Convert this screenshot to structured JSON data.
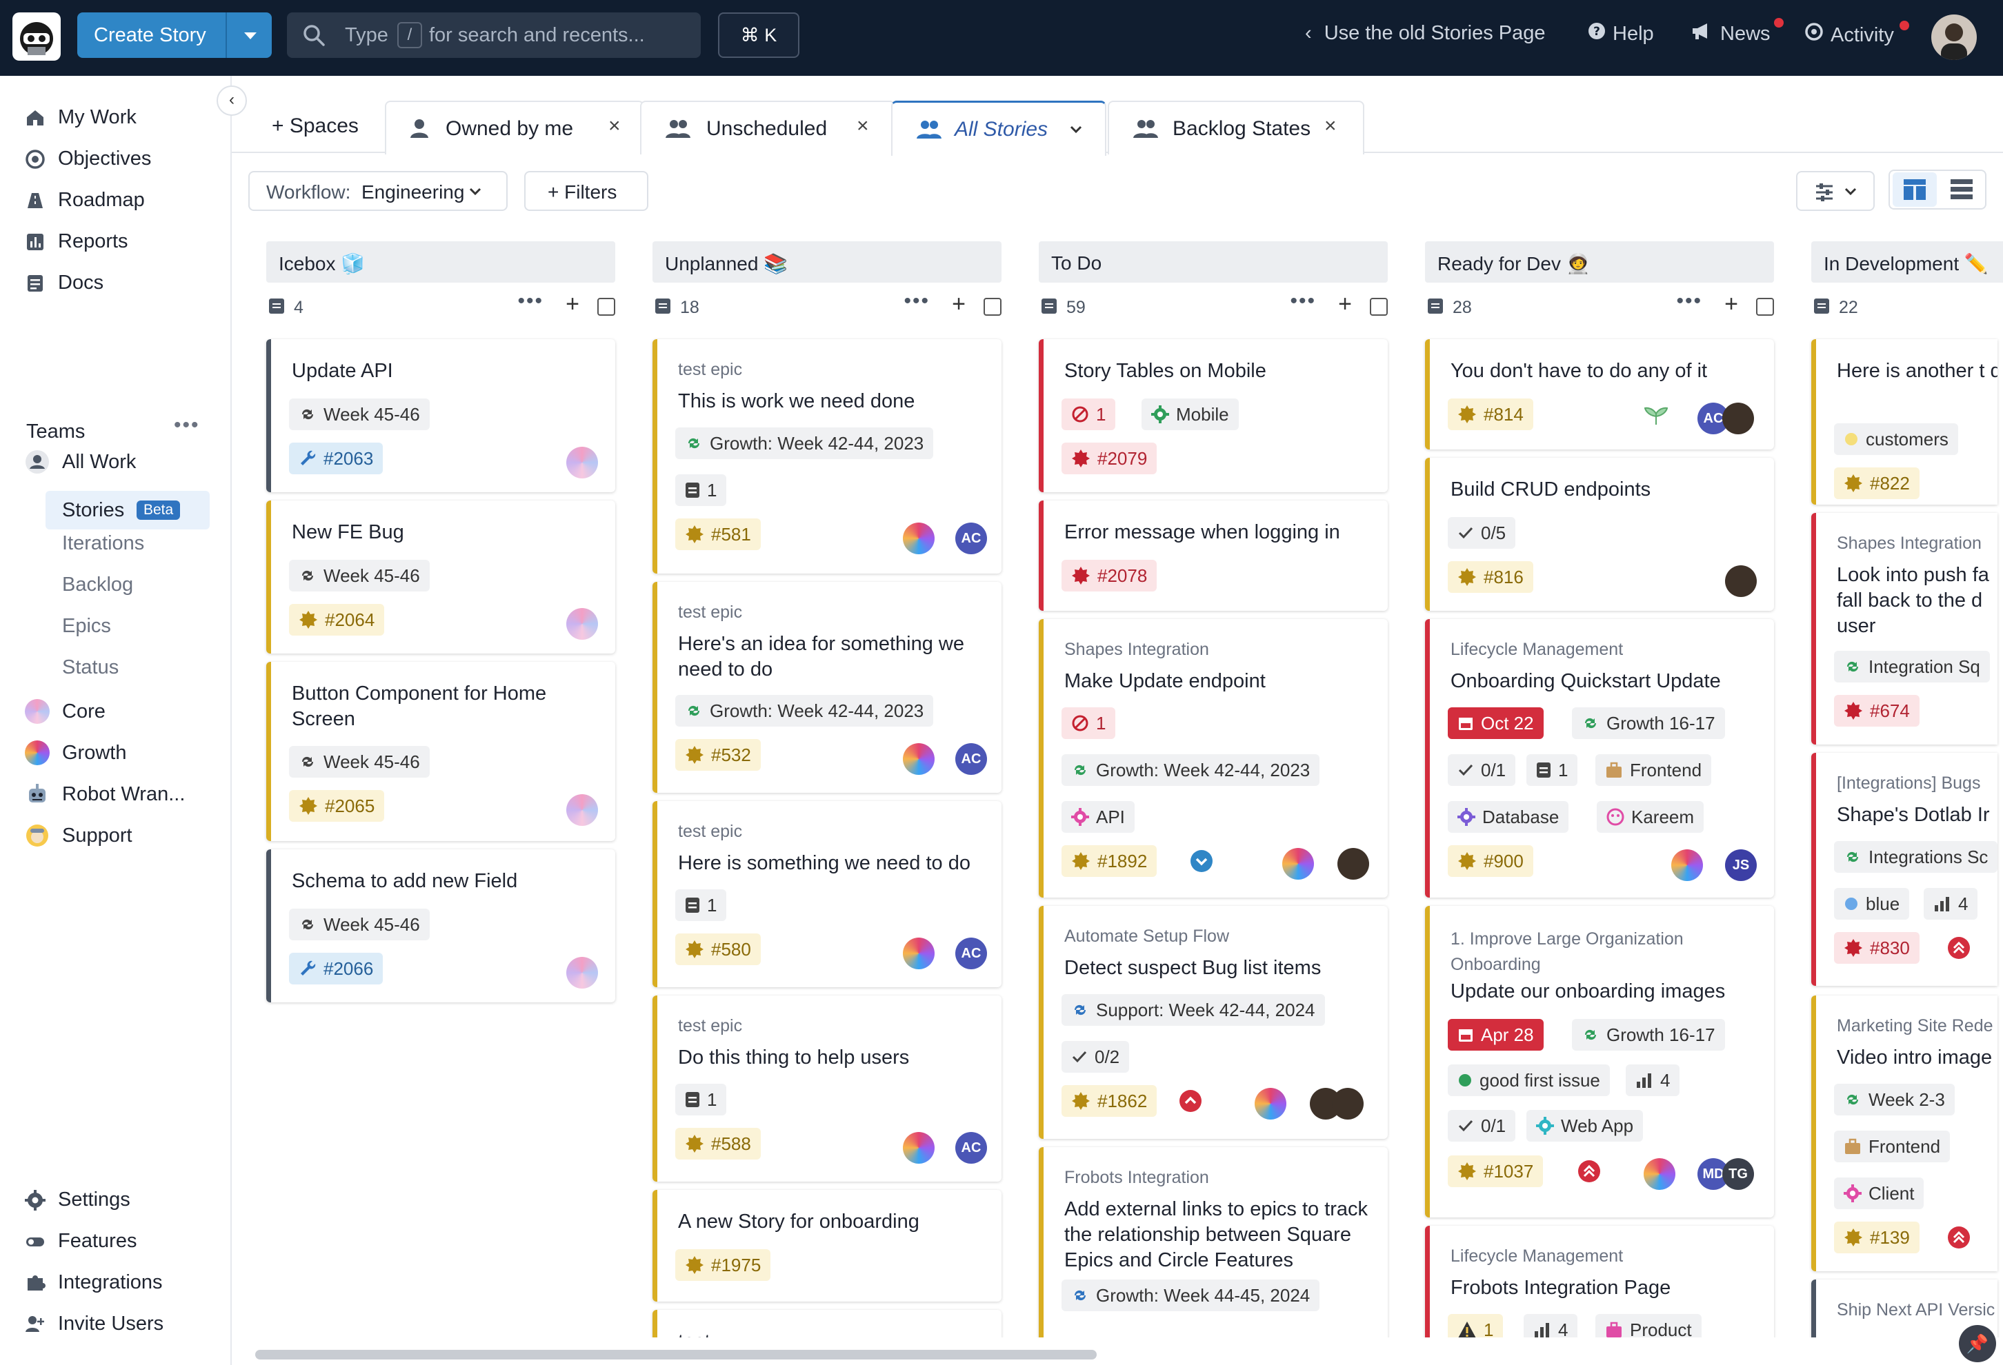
{
  "topbar": {
    "create_label": "Create Story",
    "search_type": "Type",
    "search_slash": "/",
    "search_rest": "for search and recents...",
    "kbd": "⌘ K",
    "old_page": "Use the old Stories Page",
    "help": "Help",
    "news": "News",
    "activity": "Activity"
  },
  "sidebar": {
    "nav": [
      "My Work",
      "Objectives",
      "Roadmap",
      "Reports",
      "Docs"
    ],
    "teams_header": "Teams",
    "all_work": "All Work",
    "stories": "Stories",
    "beta": "Beta",
    "sub": [
      "Iterations",
      "Backlog",
      "Epics",
      "Status"
    ],
    "teams": [
      "Core",
      "Growth",
      "Robot Wran...",
      "Support"
    ],
    "bottom": [
      "Settings",
      "Features",
      "Integrations",
      "Invite Users"
    ]
  },
  "tabs": {
    "spaces": "+ Spaces",
    "owned": "Owned by me",
    "unscheduled": "Unscheduled",
    "all": "All Stories",
    "backlog": "Backlog States"
  },
  "toolbar": {
    "workflow_prefix": "Workflow:",
    "workflow_value": "Engineering",
    "filters": "+ Filters"
  },
  "columns": [
    {
      "name": "Icebox 🧊",
      "count": "4"
    },
    {
      "name": "Unplanned 📚",
      "count": "18"
    },
    {
      "name": "To Do",
      "count": "59"
    },
    {
      "name": "Ready for Dev 🧑‍🚀",
      "count": "28"
    },
    {
      "name": "In Development ✏️",
      "count": "22"
    }
  ],
  "cards": {
    "icebox": [
      {
        "title": "Update API",
        "iter": "Week 45-46",
        "id": "#2063"
      },
      {
        "title": "New FE Bug",
        "iter": "Week 45-46",
        "id": "#2064"
      },
      {
        "title": "Button Component for Home Screen",
        "iter": "Week 45-46",
        "id": "#2065"
      },
      {
        "title": "Schema to add new Field",
        "iter": "Week 45-46",
        "id": "#2066"
      }
    ],
    "unplanned": [
      {
        "epic": "test epic",
        "title": "This is work we need done",
        "iter": "Growth: Week 42-44, 2023",
        "docs": "1",
        "id": "#581",
        "av": "AC"
      },
      {
        "epic": "test epic",
        "title": "Here's an idea for something we need to do",
        "iter": "Growth: Week 42-44, 2023",
        "id": "#532",
        "av": "AC"
      },
      {
        "epic": "test epic",
        "title": "Here is something we need to do",
        "docs": "1",
        "id": "#580",
        "av": "AC"
      },
      {
        "epic": "test epic",
        "title": "Do this thing to help users",
        "docs": "1",
        "id": "#588",
        "av": "AC"
      },
      {
        "title": "A new Story for onboarding",
        "id": "#1975"
      },
      {
        "title": "test"
      }
    ],
    "todo": [
      {
        "title": "Story Tables on Mobile",
        "blocked": "1",
        "label": "Mobile",
        "id": "#2079"
      },
      {
        "title": "Error message when logging in",
        "id": "#2078"
      },
      {
        "epic": "Shapes Integration",
        "title": "Make Update endpoint",
        "blocked": "1",
        "iter": "Growth: Week 42-44, 2023",
        "label": "API",
        "id": "#1892"
      },
      {
        "epic": "Automate Setup Flow",
        "title": "Detect suspect Bug list items",
        "iter": "Support: Week 42-44, 2024",
        "tasks": "0/2",
        "id": "#1862"
      },
      {
        "epic": "Frobots Integration",
        "title": "Add external links to epics to track the relationship between Square Epics and Circle Features",
        "iter": "Growth: Week 44-45, 2024"
      }
    ],
    "ready": [
      {
        "title": "You don't have to do any of it",
        "id": "#814",
        "av": "AC"
      },
      {
        "title": "Build CRUD endpoints",
        "tasks": "0/5",
        "id": "#816"
      },
      {
        "epic": "Lifecycle Management",
        "title": "Onboarding Quickstart Update",
        "date": "Oct 22",
        "iter": "Growth 16-17",
        "tasks": "0/1",
        "docs": "1",
        "label1": "Frontend",
        "label2": "Database",
        "label3": "Kareem",
        "id": "#900",
        "av": "JS"
      },
      {
        "epic": "1. Improve Large Organization Onboarding",
        "title": "Update our onboarding images",
        "date": "Apr 28",
        "iter": "Growth 16-17",
        "label1": "good first issue",
        "est": "4",
        "tasks": "0/1",
        "label2": "Web App",
        "id": "#1037",
        "av1": "MD",
        "av2": "TG"
      },
      {
        "epic": "Lifecycle Management",
        "title": "Frobots Integration Page",
        "warn": "1",
        "est": "4",
        "label": "Product"
      }
    ],
    "indev": [
      {
        "title": "Here is another t do",
        "label": "customers",
        "id": "#822"
      },
      {
        "epic": "Shapes Integration",
        "title": "Look into push fa fall back to the d user",
        "iter": "Integration Sq",
        "id": "#674"
      },
      {
        "epic": "[Integrations] Bugs",
        "title": "Shape's Dotlab Ir",
        "iter": "Integrations Sc",
        "label": "blue",
        "est": "4",
        "id": "#830"
      },
      {
        "epic": "Marketing Site Rede",
        "title": "Video intro image",
        "iter": "Week 2-3",
        "label1": "Frontend",
        "label2": "Client",
        "id": "#139"
      },
      {
        "epic": "Ship Next API Versic"
      }
    ]
  },
  "colors": {
    "topbar": "#101d2f",
    "accent": "#2f86c6",
    "bug": "#d32d3d",
    "feature": "#d9ae22",
    "chore": "#4b5563"
  }
}
